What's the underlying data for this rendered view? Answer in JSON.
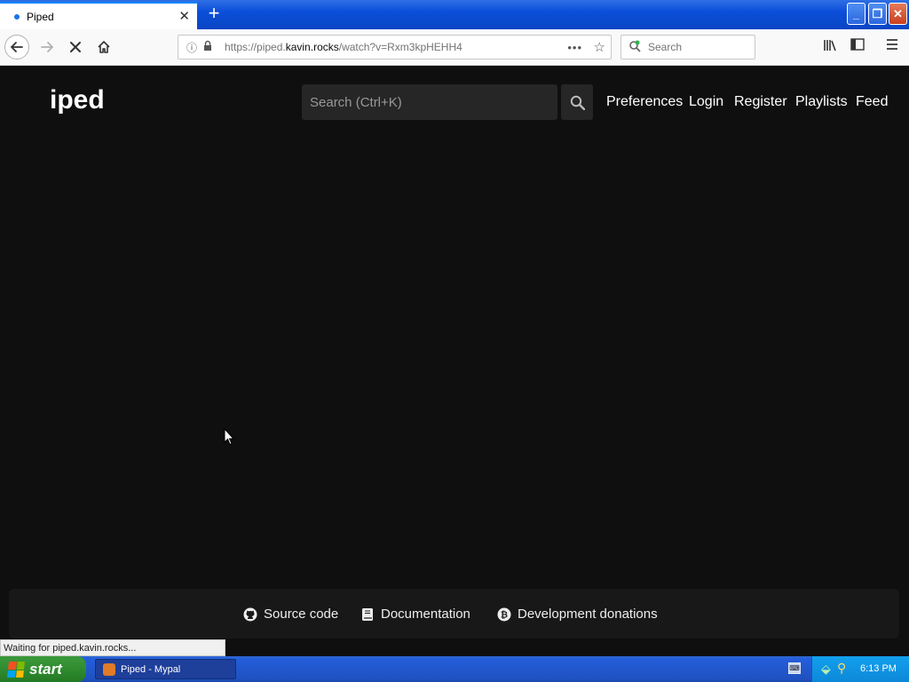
{
  "browser": {
    "tab_title": "Piped",
    "tab_close": "✕",
    "new_tab": "+",
    "window_buttons": {
      "minimize": "_",
      "maximize": "❐",
      "close": "✕"
    },
    "url_scheme_host_prefix": "https://piped.",
    "url_host": "kavin.rocks",
    "url_path": "/watch?v=Rxm3kpHEHH4",
    "page_actions": "•••",
    "search_placeholder": "Search",
    "status_text": "Waiting for piped.kavin.rocks..."
  },
  "page": {
    "logo": "iped",
    "search_placeholder": "Search (Ctrl+K)",
    "nav": [
      "Preferences",
      "Login",
      "Register",
      "Playlists",
      "Feed"
    ],
    "footer": {
      "source_code": "Source code",
      "documentation": "Documentation",
      "donations": "Development donations"
    }
  },
  "taskbar": {
    "start_label": "start",
    "task_label": "Piped - Mypal",
    "clock": "6:13 PM"
  },
  "icons": {
    "back": "arrow-left-icon",
    "forward": "arrow-right-icon",
    "stop": "close-icon",
    "home": "home-icon",
    "info": "info-icon",
    "lock": "lock-icon",
    "bookmark": "star-icon",
    "library": "library-icon",
    "sidebar": "sidebar-icon",
    "menu": "hamburger-icon",
    "page_search": "search-icon",
    "github": "github-icon",
    "book": "book-icon",
    "bitcoin": "bitcoin-icon"
  },
  "colors": {
    "page_background": "#0f0f0f",
    "footer_background": "#181818",
    "input_background": "#262626",
    "xp_blue": "#245edb",
    "start_green": "#2f8b2f"
  }
}
